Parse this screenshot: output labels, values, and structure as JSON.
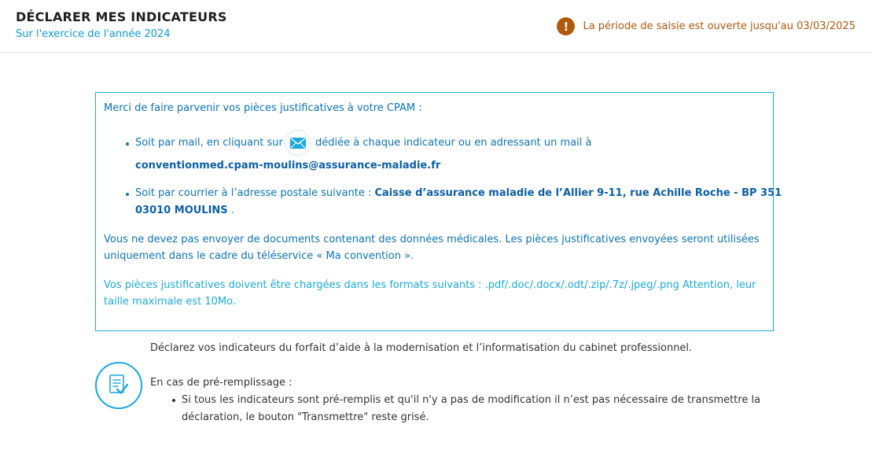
{
  "header": {
    "title": "DÉCLARER MES INDICATEURS",
    "subtitle": "Sur l'exercice de l'année 2024",
    "alert_symbol": "!",
    "deadline": "La période de saisie est ouverte jusqu'au 03/03/2025"
  },
  "info_box": {
    "intro": "Merci de faire parvenir vos pièces justificatives à votre CPAM :",
    "mail_item": {
      "before_icon": "Soit par mail, en cliquant sur",
      "after_icon": "dédiée à chaque indicateur ou en adressant un mail à",
      "email": "conventionmed.cpam-moulins@assurance-maladie.fr"
    },
    "post_item": {
      "prefix": "Soit par courrier à l’adresse postale suivante :",
      "address_line1": "Caisse d’assurance maladie de l’Allier 9-11, rue Achille Roche - BP 351",
      "address_line2": "03010 MOULINS",
      "suffix": "."
    },
    "medical_notice": {
      "line1": "Vous ne devez pas envoyer de documents contenant des données médicales. Les pièces justificatives envoyées seront utilisées",
      "line2": "uniquement dans le cadre du téléservice « Ma convention »."
    },
    "formats_notice": {
      "line1": "Vos pièces justificatives doivent être chargées dans les formats suivants : .pdf/.doc/.docx/.odt/.zip/.7z/.jpeg/.png Attention, leur",
      "line2": "taille maximale est 10Mo."
    }
  },
  "main": {
    "intro": "Déclarez vos indicateurs du forfait d’aide à la modernisation et l’informatisation du cabinet professionnel.",
    "prefill_title": "En cas de pré-remplissage :",
    "prefill_line1": "Si tous les indicateurs sont pré-remplis et qu'il n'y a pas de modification il n’est pas nécessaire de transmettre la",
    "prefill_line2": "déclaration, le bouton \"Transmettre\" reste grisé."
  },
  "colors": {
    "accent": "#1aa9dc",
    "link_blue": "#0c73b6",
    "warning": "#b0580e"
  },
  "icons": [
    "alert-icon",
    "mail-icon",
    "document-check-icon"
  ]
}
